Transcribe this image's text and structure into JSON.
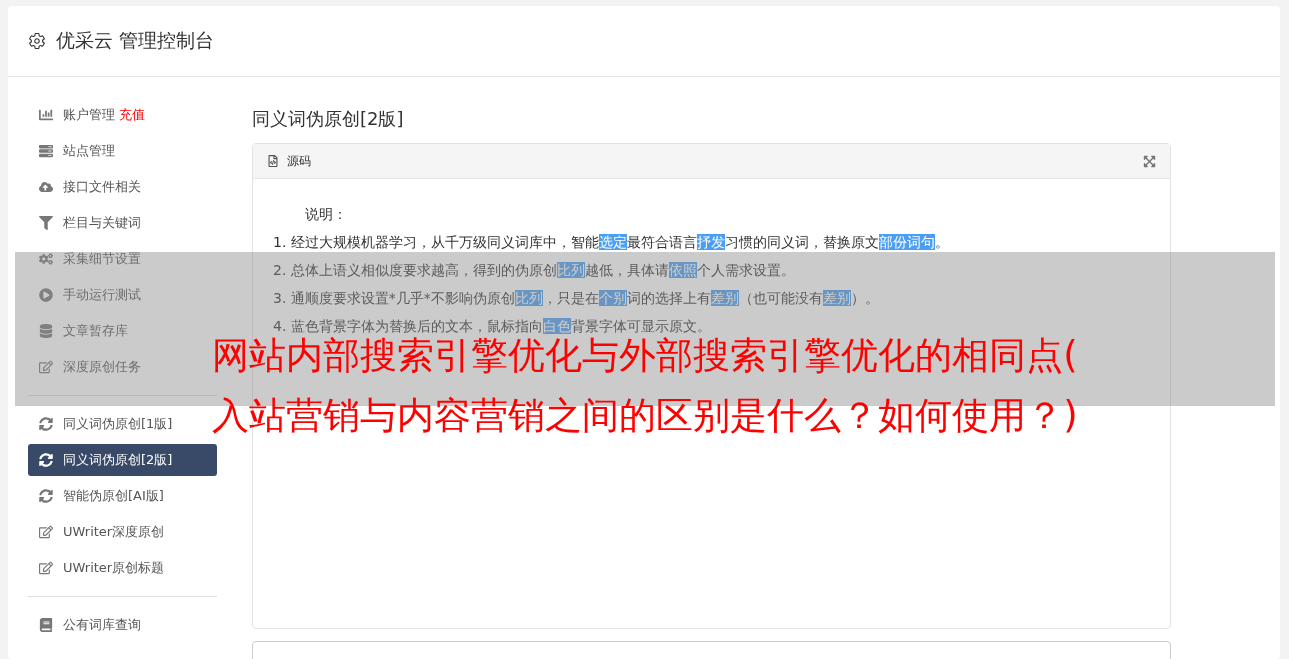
{
  "header": {
    "title": "优采云 管理控制台"
  },
  "sidebar": {
    "groups": [
      {
        "items": [
          {
            "label": "账户管理",
            "badge": "充值",
            "selected": false
          },
          {
            "label": "站点管理",
            "selected": false
          },
          {
            "label": "接口文件相关",
            "selected": false
          },
          {
            "label": "栏目与关键词",
            "selected": false
          },
          {
            "label": "采集细节设置",
            "selected": false
          },
          {
            "label": "手动运行测试",
            "selected": false
          },
          {
            "label": "文章暂存库",
            "selected": false
          },
          {
            "label": "深度原创任务",
            "selected": false
          }
        ]
      },
      {
        "items": [
          {
            "label": "同义词伪原创[1版]",
            "selected": false
          },
          {
            "label": "同义词伪原创[2版]",
            "selected": true
          },
          {
            "label": "智能伪原创[AI版]",
            "selected": false
          },
          {
            "label": "UWriter深度原创",
            "selected": false
          },
          {
            "label": "UWriter原创标题",
            "selected": false
          }
        ]
      },
      {
        "items": [
          {
            "label": "公有词库查询",
            "selected": false
          }
        ]
      }
    ]
  },
  "page_title": "同义词伪原创[2版]",
  "panel": {
    "title": "源码",
    "heading": "说明：",
    "lines": [
      [
        {
          "text": "1. 经过大规模机器学习，从千万级同义词库中，智能",
          "highlighted": false
        },
        {
          "text": "选定",
          "highlighted": true
        },
        {
          "text": "最符合语言",
          "highlighted": false
        },
        {
          "text": "抒发",
          "highlighted": true
        },
        {
          "text": "习惯的同义词，替换原文",
          "highlighted": false
        },
        {
          "text": "部份",
          "highlighted": true
        },
        {
          "text": "词句",
          "highlighted": true
        },
        {
          "text": "。",
          "highlighted": false
        }
      ],
      [
        {
          "text": "2. 总体上语义相似度要求越高，得到的伪原创",
          "highlighted": false
        },
        {
          "text": "比列",
          "highlighted": true
        },
        {
          "text": "越低，具体请",
          "highlighted": false
        },
        {
          "text": "依照",
          "highlighted": true
        },
        {
          "text": "个人需求设置。",
          "highlighted": false
        }
      ],
      [
        {
          "text": "3. 通顺度要求设置*几乎*不影响伪原创",
          "highlighted": false
        },
        {
          "text": "比列",
          "highlighted": true
        },
        {
          "text": "，只是在",
          "highlighted": false
        },
        {
          "text": "个别",
          "highlighted": true
        },
        {
          "text": "词的选择上有",
          "highlighted": false
        },
        {
          "text": "差别",
          "highlighted": true
        },
        {
          "text": "（也可能没有",
          "highlighted": false
        },
        {
          "text": "差别",
          "highlighted": true
        },
        {
          "text": "）。",
          "highlighted": false
        }
      ],
      [
        {
          "text": "4. 蓝色背景字体为替换后的文本，鼠标指向",
          "highlighted": false
        },
        {
          "text": "白色",
          "highlighted": true
        },
        {
          "text": "背景字体可显示原文。",
          "highlighted": false
        }
      ]
    ]
  },
  "banner": {
    "lines": [
      "网站内部搜索引擎优化与外部搜索引擎优化的相同点(",
      "入站营销与内容营销之间的区别是什么？如何使用？)"
    ]
  }
}
